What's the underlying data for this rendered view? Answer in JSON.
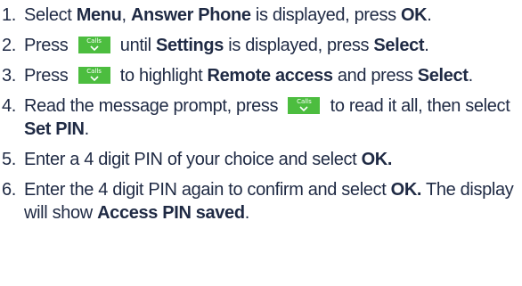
{
  "colors": {
    "text": "#1f2a44",
    "key_background": "#4cbd3f",
    "key_text": "#ffffff"
  },
  "key": {
    "label": "Calls",
    "icon": "chevron-down-icon"
  },
  "steps": [
    {
      "num": "1.",
      "segments": [
        "Select ",
        "Menu",
        ", ",
        "Answer Phone",
        " is displayed, press ",
        "OK",
        "."
      ]
    },
    {
      "num": "2.",
      "segments": [
        "Press ",
        " until ",
        "Settings",
        " is displayed, press ",
        "Select",
        "."
      ]
    },
    {
      "num": "3.",
      "segments": [
        "Press ",
        " to highlight ",
        "Remote access",
        " and press ",
        "Select",
        "."
      ]
    },
    {
      "num": "4.",
      "segments": [
        "Read the message prompt, press ",
        " to read it all, then select ",
        "Set PIN",
        "."
      ]
    },
    {
      "num": "5.",
      "segments": [
        "Enter a 4 digit PIN of your choice and select ",
        "OK."
      ]
    },
    {
      "num": "6.",
      "segments": [
        "Enter the 4 digit PIN again to confirm and select ",
        "OK.",
        " The display will show ",
        "Access PIN saved",
        "."
      ]
    }
  ]
}
